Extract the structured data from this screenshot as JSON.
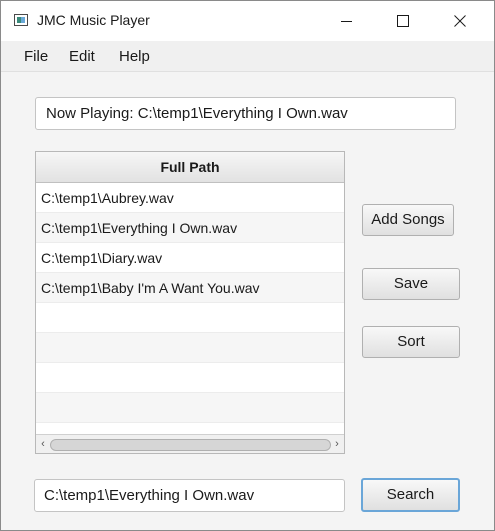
{
  "window": {
    "title": "JMC Music Player",
    "controls": [
      "minimize-icon",
      "maximize-icon",
      "close-icon"
    ]
  },
  "menu": {
    "items": [
      "File",
      "Edit",
      "Help"
    ]
  },
  "now_playing": {
    "value": "Now Playing: C:\\temp1\\Everything I Own.wav"
  },
  "table": {
    "header": "Full Path",
    "rows": [
      "C:\\temp1\\Aubrey.wav",
      "C:\\temp1\\Everything I Own.wav",
      "C:\\temp1\\Diary.wav",
      "C:\\temp1\\Baby I'm A Want You.wav"
    ]
  },
  "buttons": {
    "add_songs": "Add Songs",
    "save": "Save",
    "sort": "Sort",
    "search": "Search"
  },
  "search": {
    "value": "C:\\temp1\\Everything I Own.wav"
  },
  "colors": {
    "focus_accent": "#6aa6d8",
    "window_background": "#f4f4f4"
  }
}
